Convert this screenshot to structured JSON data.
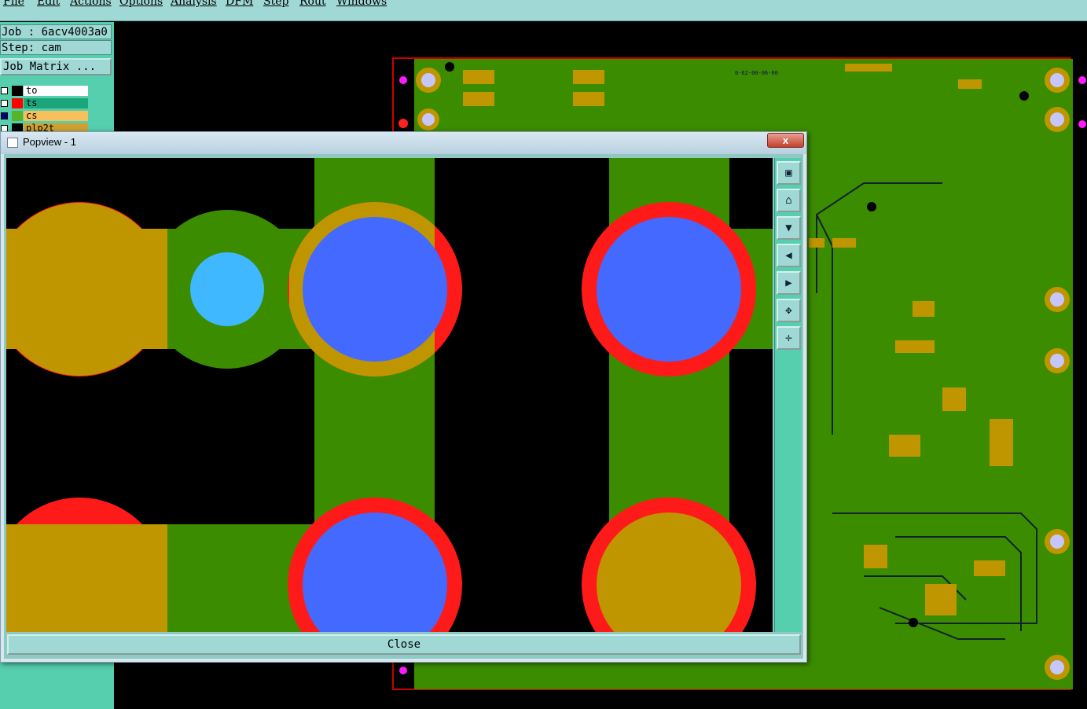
{
  "menu": [
    "File",
    "Edit",
    "Actions",
    "Options",
    "Analysis",
    "DFM",
    "Step",
    "Rout",
    "Windows"
  ],
  "job_panel": {
    "job_line": "Job : 6acv4003a0",
    "step_line": "Step: cam",
    "job_matrix_button": "Job Matrix ..."
  },
  "layers": [
    {
      "name": "to",
      "color": "#000000",
      "bg": "#ffffff"
    },
    {
      "name": "ts",
      "color": "#ff0000",
      "bg": "#1aa57a"
    },
    {
      "name": "cs",
      "color": "#55b42a",
      "bg": "#f6c05c"
    },
    {
      "name": "plp2t",
      "color": "#000000",
      "bg": "#d0a030"
    }
  ],
  "popview": {
    "title": "Popview - 1",
    "close_x": "x",
    "close_button": "Close",
    "toolbar": [
      "window-icon",
      "zoom-home-icon",
      "zoom-in-icon",
      "pan-left-icon",
      "pan-right-icon",
      "zoom-fit-icon",
      "pan-all-icon"
    ]
  },
  "board_label": "0-62-00-06-00",
  "colors": {
    "board_green": "#3c8c00",
    "pad_gold": "#bf9600",
    "copper_red": "#ff1a1a",
    "drill_blue": "#4469ff",
    "via_cyan": "#3fb8ff",
    "teal_ui": "#9fd8d4",
    "teal_panel": "#55cfae"
  }
}
